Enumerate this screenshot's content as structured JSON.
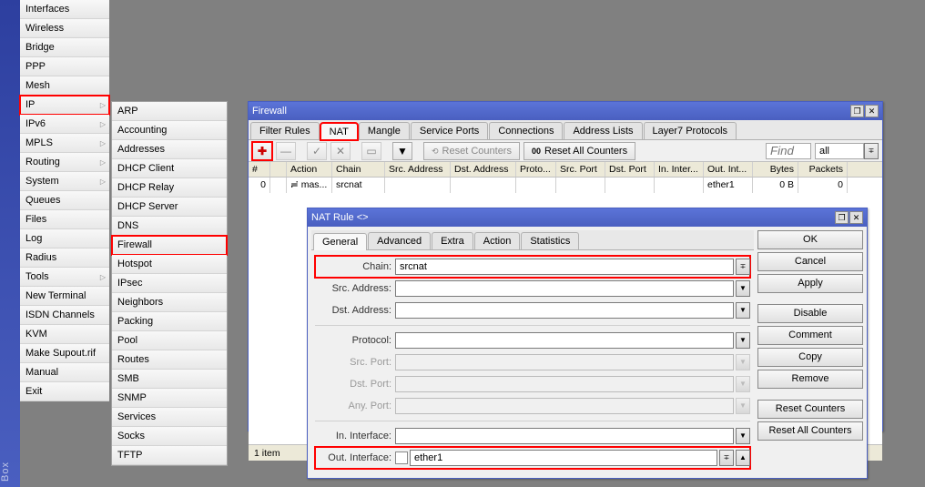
{
  "sidebar_label": "Box",
  "menu": {
    "items": [
      {
        "label": "Interfaces"
      },
      {
        "label": "Wireless"
      },
      {
        "label": "Bridge"
      },
      {
        "label": "PPP"
      },
      {
        "label": "Mesh"
      },
      {
        "label": "IP",
        "arrow": true,
        "red": true
      },
      {
        "label": "IPv6",
        "arrow": true
      },
      {
        "label": "MPLS",
        "arrow": true
      },
      {
        "label": "Routing",
        "arrow": true
      },
      {
        "label": "System",
        "arrow": true
      },
      {
        "label": "Queues"
      },
      {
        "label": "Files"
      },
      {
        "label": "Log"
      },
      {
        "label": "Radius"
      },
      {
        "label": "Tools",
        "arrow": true
      },
      {
        "label": "New Terminal"
      },
      {
        "label": "ISDN Channels"
      },
      {
        "label": "KVM"
      },
      {
        "label": "Make Supout.rif"
      },
      {
        "label": "Manual"
      },
      {
        "label": "Exit"
      }
    ]
  },
  "submenu": {
    "items": [
      "ARP",
      "Accounting",
      "Addresses",
      "DHCP Client",
      "DHCP Relay",
      "DHCP Server",
      "DNS",
      "Firewall",
      "Hotspot",
      "IPsec",
      "Neighbors",
      "Packing",
      "Pool",
      "Routes",
      "SMB",
      "SNMP",
      "Services",
      "Socks",
      "TFTP"
    ],
    "red_index": 7
  },
  "firewall": {
    "title": "Firewall",
    "tabs": [
      "Filter Rules",
      "NAT",
      "Mangle",
      "Service Ports",
      "Connections",
      "Address Lists",
      "Layer7 Protocols"
    ],
    "active_tab": 1,
    "toolbar": {
      "reset_counters": "Reset Counters",
      "reset_all": "Reset All Counters",
      "find_placeholder": "Find",
      "filter_all": "all"
    },
    "columns": [
      "#",
      "",
      "Action",
      "Chain",
      "Src. Address",
      "Dst. Address",
      "Proto...",
      "Src. Port",
      "Dst. Port",
      "In. Inter...",
      "Out. Int...",
      "Bytes",
      "Packets"
    ],
    "row": {
      "num": "0",
      "action_icon": "≓",
      "action": "mas...",
      "chain": "srcnat",
      "out_int": "ether1",
      "bytes": "0 B",
      "packets": "0"
    },
    "status": "1 item"
  },
  "natrule": {
    "title": "NAT Rule <>",
    "tabs": [
      "General",
      "Advanced",
      "Extra",
      "Action",
      "Statistics"
    ],
    "active_tab": 0,
    "fields": {
      "chain_label": "Chain:",
      "chain_value": "srcnat",
      "src_addr_label": "Src. Address:",
      "dst_addr_label": "Dst. Address:",
      "protocol_label": "Protocol:",
      "src_port_label": "Src. Port:",
      "dst_port_label": "Dst. Port:",
      "any_port_label": "Any. Port:",
      "in_int_label": "In. Interface:",
      "out_int_label": "Out. Interface:",
      "out_int_value": "ether1"
    },
    "buttons": {
      "ok": "OK",
      "cancel": "Cancel",
      "apply": "Apply",
      "disable": "Disable",
      "comment": "Comment",
      "copy": "Copy",
      "remove": "Remove",
      "reset_counters": "Reset Counters",
      "reset_all": "Reset All Counters"
    }
  }
}
